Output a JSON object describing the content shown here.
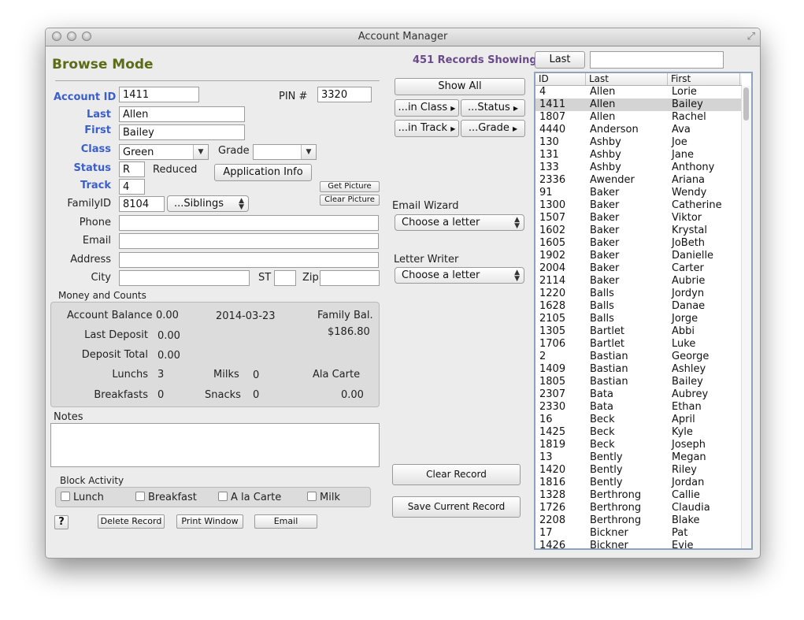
{
  "window": {
    "title": "Account Manager"
  },
  "mode": "Browse Mode",
  "records_showing": "451 Records Showing",
  "sort_button": "Last",
  "search_value": "",
  "form": {
    "account_id_label": "Account ID",
    "account_id": "1411",
    "pin_label": "PIN #",
    "pin": "3320",
    "last_label": "Last",
    "last": "Allen",
    "first_label": "First",
    "first": "Bailey",
    "class_label": "Class",
    "class_value": "Green",
    "grade_label": "Grade",
    "grade_value": "",
    "status_label": "Status",
    "status": "R",
    "status_text": "Reduced",
    "track_label": "Track",
    "track": "4",
    "familyid_label": "FamilyID",
    "familyid": "8104",
    "siblings": "...Siblings",
    "phone_label": "Phone",
    "phone": "",
    "email_label": "Email",
    "email": "",
    "address_label": "Address",
    "address": "",
    "city_label": "City",
    "city": "",
    "st_label": "ST",
    "st": "",
    "zip_label": "Zip",
    "zip": ""
  },
  "buttons": {
    "application_info": "Application Info",
    "get_picture": "Get Picture",
    "clear_picture": "Clear Picture",
    "show_all": "Show All",
    "in_class": "...in Class",
    "status": "...Status",
    "in_track": "...in Track",
    "grade": "...Grade",
    "clear_record": "Clear Record",
    "save_record": "Save Current Record",
    "help": "?",
    "delete_record": "Delete Record",
    "print_window": "Print Window",
    "email": "Email"
  },
  "email_wizard": {
    "label": "Email Wizard",
    "value": "Choose a letter"
  },
  "letter_writer": {
    "label": "Letter Writer",
    "value": "Choose a letter"
  },
  "money": {
    "section_label": "Money and Counts",
    "account_balance_label": "Account Balance",
    "account_balance": "0.00",
    "date": "2014-03-23",
    "family_bal_label": "Family Bal.",
    "family_bal": "$186.80",
    "last_deposit_label": "Last Deposit",
    "last_deposit": "0.00",
    "deposit_total_label": "Deposit Total",
    "deposit_total": "0.00",
    "lunchs_label": "Lunchs",
    "lunchs": "3",
    "milks_label": "Milks",
    "milks": "0",
    "ala_carte_label": "Ala Carte",
    "ala_carte": "0.00",
    "breakfasts_label": "Breakfasts",
    "breakfasts": "0",
    "snacks_label": "Snacks",
    "snacks": "0"
  },
  "notes": {
    "label": "Notes",
    "value": ""
  },
  "block_activity": {
    "label": "Block Activity",
    "items": [
      "Lunch",
      "Breakfast",
      "A la Carte",
      "Milk"
    ]
  },
  "list": {
    "columns": [
      "ID",
      "Last",
      "First"
    ],
    "selected_id": "1411",
    "rows": [
      [
        "4",
        "Allen",
        "Lorie"
      ],
      [
        "1411",
        "Allen",
        "Bailey"
      ],
      [
        "1807",
        "Allen",
        "Rachel"
      ],
      [
        "4440",
        "Anderson",
        "Ava"
      ],
      [
        "130",
        "Ashby",
        "Joe"
      ],
      [
        "131",
        "Ashby",
        "Jane"
      ],
      [
        "133",
        "Ashby",
        "Anthony"
      ],
      [
        "2336",
        "Awender",
        "Ariana"
      ],
      [
        "91",
        "Baker",
        "Wendy"
      ],
      [
        "1300",
        "Baker",
        "Catherine"
      ],
      [
        "1507",
        "Baker",
        "Viktor"
      ],
      [
        "1602",
        "Baker",
        "Krystal"
      ],
      [
        "1605",
        "Baker",
        "JoBeth"
      ],
      [
        "1902",
        "Baker",
        "Danielle"
      ],
      [
        "2004",
        "Baker",
        "Carter"
      ],
      [
        "2114",
        "Baker",
        "Aubrie"
      ],
      [
        "1220",
        "Balls",
        "Jordyn"
      ],
      [
        "1628",
        "Balls",
        "Danae"
      ],
      [
        "2105",
        "Balls",
        "Jorge"
      ],
      [
        "1305",
        "Bartlet",
        "Abbi"
      ],
      [
        "1706",
        "Bartlet",
        "Luke"
      ],
      [
        "2",
        "Bastian",
        "George"
      ],
      [
        "1409",
        "Bastian",
        "Ashley"
      ],
      [
        "1805",
        "Bastian",
        "Bailey"
      ],
      [
        "2307",
        "Bata",
        "Aubrey"
      ],
      [
        "2330",
        "Bata",
        "Ethan"
      ],
      [
        "16",
        "Beck",
        "April"
      ],
      [
        "1425",
        "Beck",
        "Kyle"
      ],
      [
        "1819",
        "Beck",
        "Joseph"
      ],
      [
        "13",
        "Bently",
        "Megan"
      ],
      [
        "1420",
        "Bently",
        "Riley"
      ],
      [
        "1816",
        "Bently",
        "Jordan"
      ],
      [
        "1328",
        "Berthrong",
        "Callie"
      ],
      [
        "1726",
        "Berthrong",
        "Claudia"
      ],
      [
        "2208",
        "Berthrong",
        "Blake"
      ],
      [
        "17",
        "Bickner",
        "Pat"
      ],
      [
        "1426",
        "Bickner",
        "Evie"
      ]
    ]
  }
}
